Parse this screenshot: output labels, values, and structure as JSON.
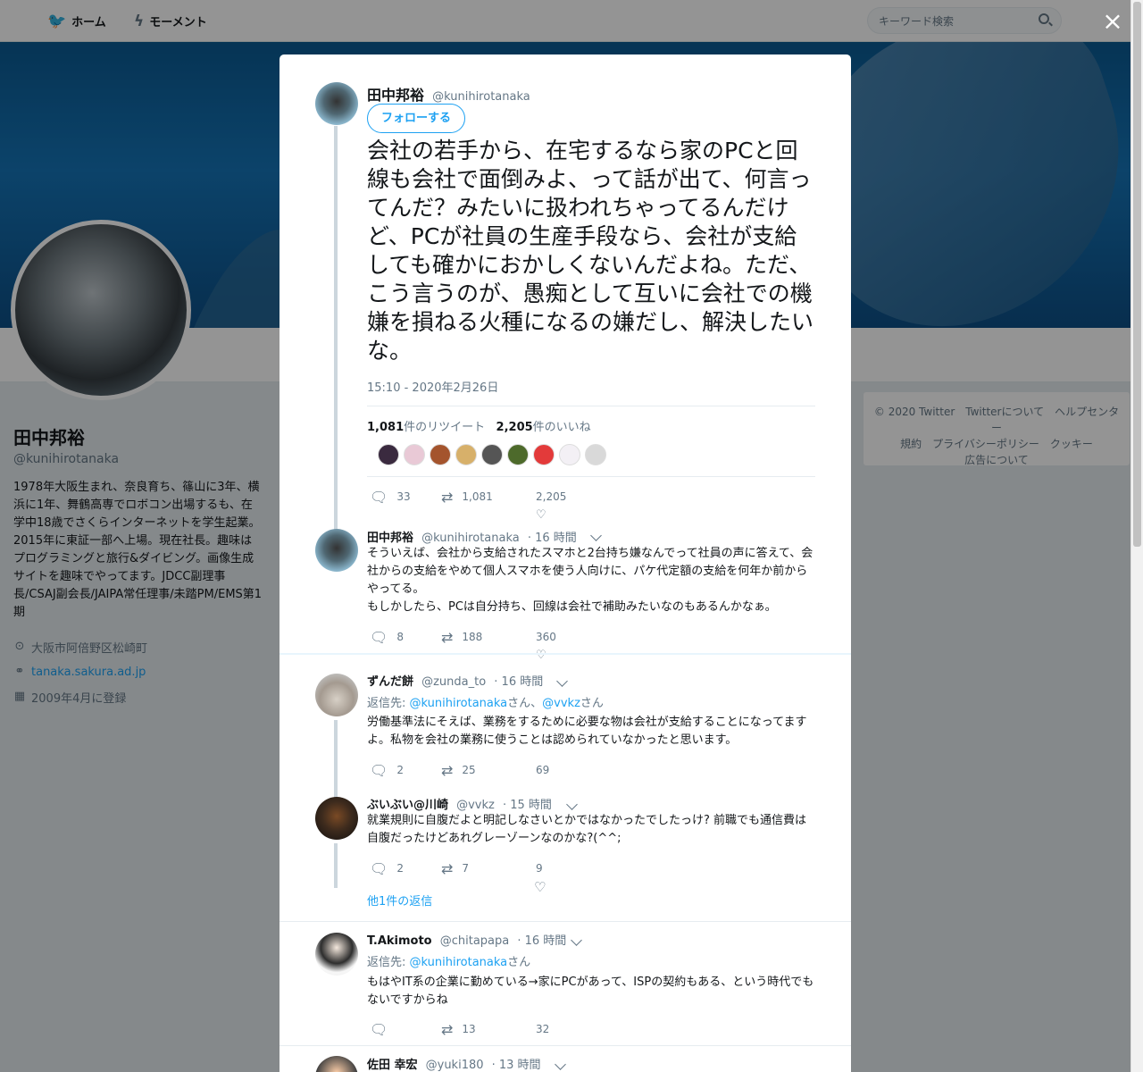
{
  "nav": {
    "home": "ホーム",
    "moments": "モーメント",
    "search_placeholder": "キーワード検索",
    "close": "×"
  },
  "profile": {
    "name": "田中邦裕",
    "handle": "@kunihirotanaka",
    "bio": "1978年大阪生まれ、奈良育ち、篠山に3年、横浜に1年、舞鶴高専でロボコン出場するも、在学中18歳でさくらインターネットを学生起業。2015年に東証一部へ上場。現在社長。趣味はプログラミングと旅行&ダイビング。画像生成サイトを趣味でやってます。JDCC副理事長/CSAJ副会長/JAIPA常任理事/未踏PM/EMS第1期",
    "location": "大阪市阿倍野区松崎町",
    "url": "tanaka.sakura.ad.jp",
    "joined": "2009年4月に登録"
  },
  "footer": {
    "line1": "© 2020 Twitter　Twitterについて　ヘルプセンター",
    "line2": "規約　プライバシーポリシー　クッキー",
    "line3": "広告について"
  },
  "colors": {
    "accent": "#1da1f2",
    "link": "#1da1f2"
  },
  "main_tweet": {
    "name": "田中邦裕",
    "handle": "@kunihirotanaka",
    "follow": "フォローする",
    "text": "会社の若手から、在宅するなら家のPCと回線も会社で面倒みよ、って話が出て、何言ってんだ？みたいに扱われちゃってるんだけど、PCが社員の生産手段なら、会社が支給しても確かにおかしくないんだよね。ただ、こう言うのが、愚痴として互いに会社での機嫌を損ねる火種になるの嫌だし、解決したいな。",
    "timestamp": "15:10 - 2020年2月26日",
    "retweets_num": "1,081",
    "retweets_label": "件のリツイート",
    "likes_num": "2,205",
    "likes_label": "件のいいね",
    "replies": "33",
    "retweets": "1,081",
    "likes": "2,205"
  },
  "replies": [
    {
      "name": "田中邦裕",
      "handle": "@kunihirotanaka",
      "time": "· 16 時間",
      "text": "そういえば、会社から支給されたスマホと2台持ち嫌なんでって社員の声に答えて、会社からの支給をやめて個人スマホを使う人向けに、パケ代定額の支給を何年か前からやってる。\nもしかしたら、PCは自分持ち、回線は会社で補助みたいなのもあるんかなぁ。",
      "replies": "8",
      "retweets": "188",
      "likes": "360"
    },
    {
      "name": "ずんだ餅",
      "handle": "@zunda_to",
      "time": "· 16 時間",
      "reply_prefix": "返信先: ",
      "reply_to1": "@kunihirotanaka",
      "reply_mid": "さん、",
      "reply_to2": "@vvkz",
      "reply_suffix": "さん",
      "text": "労働基準法にそえば、業務をするために必要な物は会社が支給することになってますよ。私物を会社の業務に使うことは認められていなかったと思います。",
      "replies": "2",
      "retweets": "25",
      "likes": "69"
    },
    {
      "name": "ぶいぶい@川崎",
      "handle": "@vvkz",
      "time": "· 15 時間",
      "text": "就業規則に自腹だよと明記しなさいとかではなかったでしたっけ? 前職でも通信費は自腹だったけどあれグレーゾーンなのかな?(^^;",
      "replies": "2",
      "retweets": "7",
      "likes": "9"
    },
    {
      "more": "他1件の返信"
    },
    {
      "name": "T.Akimoto",
      "handle": "@chitapapa",
      "time": "· 16 時間",
      "reply_prefix": "返信先: ",
      "reply_to1": "@kunihirotanaka",
      "reply_suffix": "さん",
      "text": "もはやIT系の企業に勤めている→家にPCがあって、ISPの契約もある、という時代でもないですからね",
      "replies": "",
      "retweets": "13",
      "likes": "32"
    },
    {
      "name": "佐田 幸宏",
      "handle": "@yuki180",
      "time": "· 13 時間"
    }
  ]
}
